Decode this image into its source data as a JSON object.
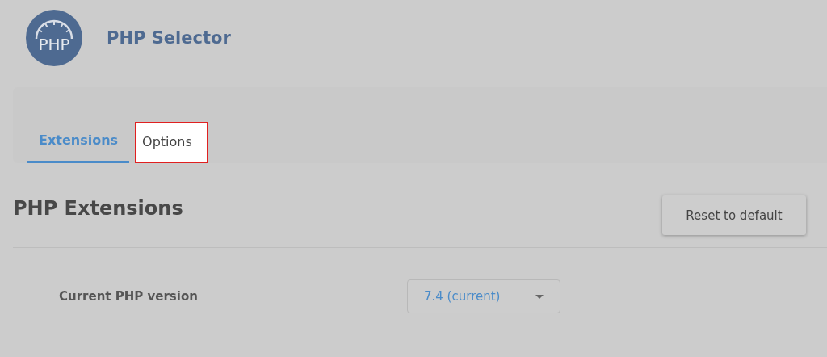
{
  "header": {
    "logo_text": "PHP",
    "title": "PHP Selector"
  },
  "tabs": [
    {
      "label": "Extensions",
      "selected": true,
      "highlighted": false
    },
    {
      "label": "Options",
      "selected": false,
      "highlighted": true
    }
  ],
  "section": {
    "title": "PHP Extensions",
    "reset_button": "Reset to default"
  },
  "version_row": {
    "label": "Current PHP version",
    "value": "7.4 (current)"
  }
}
